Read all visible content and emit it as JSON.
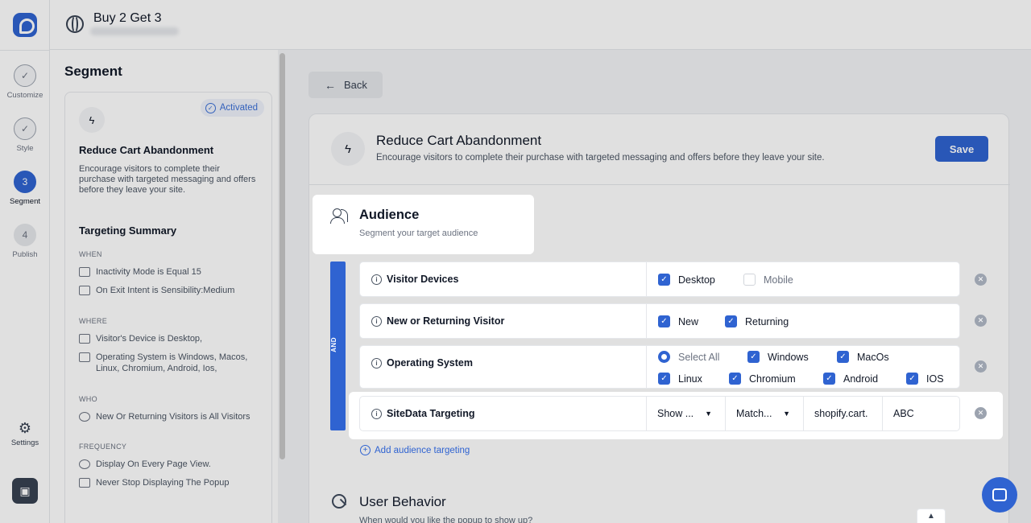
{
  "app": {
    "title": "Buy 2 Get 3"
  },
  "rail": {
    "steps": [
      {
        "label": "Customize",
        "state": "done"
      },
      {
        "label": "Style",
        "state": "done"
      },
      {
        "label": "Segment",
        "number": "3",
        "state": "active"
      },
      {
        "label": "Publish",
        "number": "4",
        "state": "pending"
      }
    ],
    "settings_label": "Settings"
  },
  "sidebar": {
    "title": "Segment",
    "card": {
      "badge": "Activated",
      "title": "Reduce Cart Abandonment",
      "description": "Encourage visitors to complete their purchase with targeted messaging and offers before they leave your site."
    },
    "summary_title": "Targeting Summary",
    "sections": {
      "when": {
        "label": "WHEN",
        "items": [
          "Inactivity Mode is Equal 15",
          "On Exit Intent is Sensibility:Medium"
        ]
      },
      "where": {
        "label": "WHERE",
        "items": [
          "Visitor's Device is Desktop,",
          "Operating System is Windows, Macos, Linux, Chromium, Android, Ios,"
        ]
      },
      "who": {
        "label": "WHO",
        "items": [
          "New Or Returning Visitors is All Visitors"
        ]
      },
      "frequency": {
        "label": "FREQUENCY",
        "items": [
          "Display On Every Page View.",
          "Never Stop Displaying The Popup"
        ]
      }
    }
  },
  "main": {
    "back_label": "Back",
    "header": {
      "title": "Reduce Cart Abandonment",
      "description": "Encourage visitors to complete their purchase with targeted messaging and offers before they leave your site.",
      "save_label": "Save"
    },
    "audience": {
      "title": "Audience",
      "subtitle": "Segment your target audience",
      "and_label": "AND",
      "rows": {
        "devices": {
          "name": "Visitor Devices",
          "options": [
            {
              "label": "Desktop",
              "checked": true
            },
            {
              "label": "Mobile",
              "checked": false
            }
          ]
        },
        "returning": {
          "name": "New or Returning Visitor",
          "options": [
            {
              "label": "New",
              "checked": true
            },
            {
              "label": "Returning",
              "checked": true
            }
          ]
        },
        "os": {
          "name": "Operating System",
          "select_all": "Select All",
          "options": [
            {
              "label": "Windows",
              "checked": true
            },
            {
              "label": "MacOs",
              "checked": true
            },
            {
              "label": "Linux",
              "checked": true
            },
            {
              "label": "Chromium",
              "checked": true
            },
            {
              "label": "Android",
              "checked": true
            },
            {
              "label": "IOS",
              "checked": true
            }
          ]
        },
        "sitedata": {
          "name": "SiteData Targeting",
          "show": "Show ...",
          "match": "Match...",
          "key": "shopify.cart.",
          "value": "ABC"
        }
      },
      "add_label": "Add audience targeting"
    },
    "behavior": {
      "title": "User Behavior",
      "subtitle": "When would you like the popup to show up?"
    }
  },
  "colors": {
    "accent": "#2f63d1"
  }
}
